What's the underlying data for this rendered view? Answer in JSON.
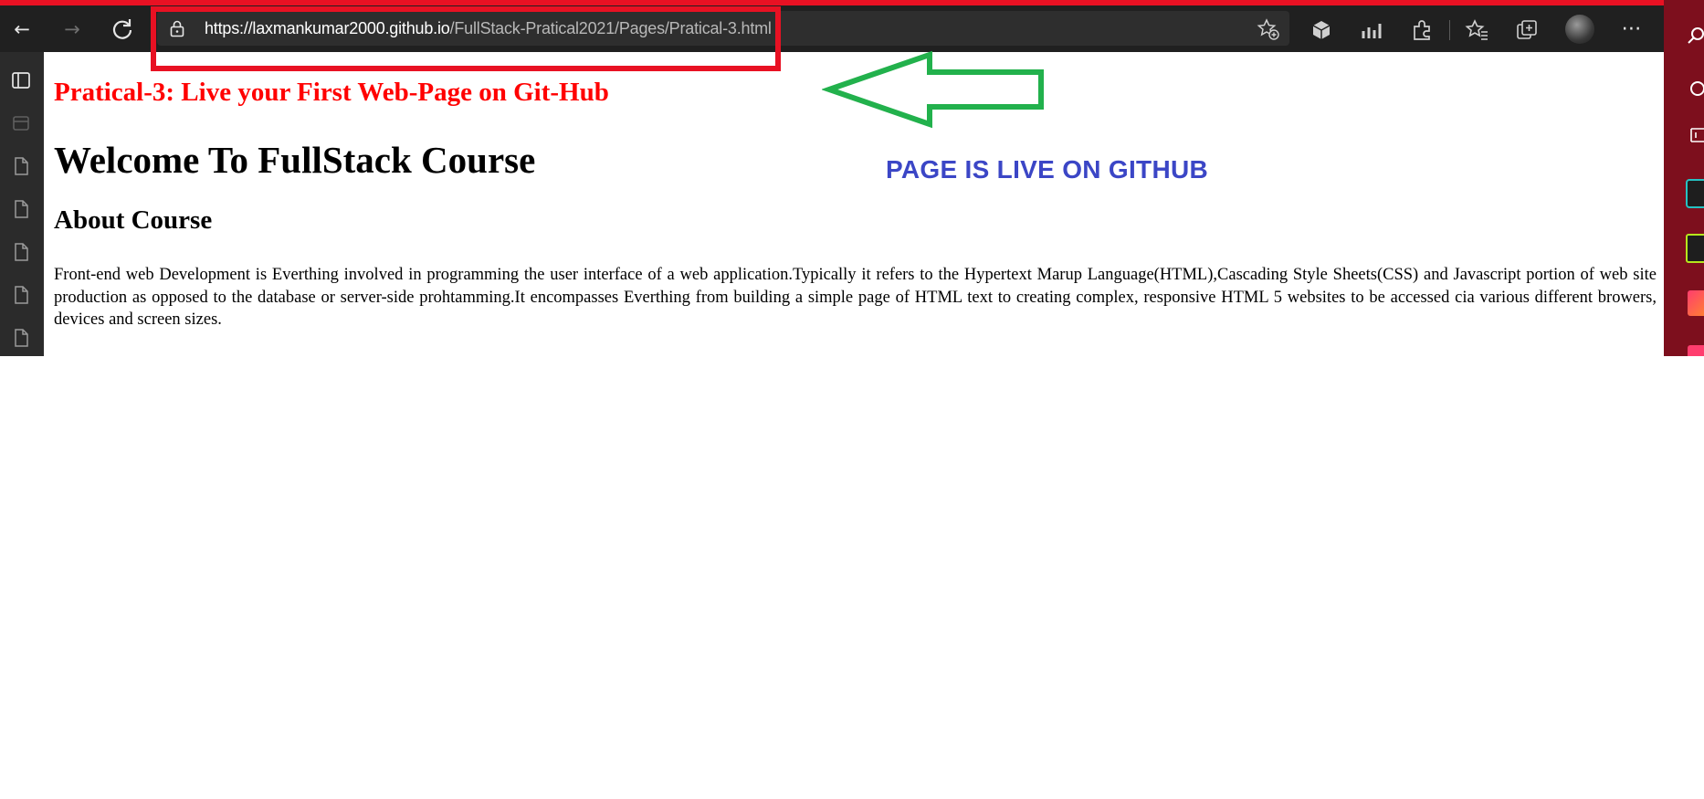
{
  "browser": {
    "address_bar": {
      "url_host": "https://laxmankumar2000.github.io",
      "url_path": "/FullStack-Pratical2021/Pages/Pratical-3.html"
    },
    "toolbar_icons": [
      "back-icon",
      "forward-icon",
      "refresh-icon",
      "lock-icon",
      "add-favorite-icon",
      "extension-cube-icon",
      "performance-icon",
      "extensions-puzzle-icon",
      "favorites-icon",
      "collections-icon",
      "profile-avatar",
      "more-options-icon"
    ],
    "sidebar_icons": [
      "tab-actions-icon",
      "saved-tab-icon",
      "page-icon",
      "page-icon",
      "page-icon",
      "page-icon",
      "page-icon"
    ],
    "highlight_color": "#e81123"
  },
  "page": {
    "practical_title": "Pratical-3: Live your First Web-Page on Git-Hub",
    "main_heading": "Welcome To FullStack Course",
    "section_heading": "About Course",
    "paragraph": "Front-end web Development is Everthing involved in programming the user interface of a web application.Typically it refers to the Hypertext Marup Language(HTML),Cascading Style Sheets(CSS) and Javascript portion of web site production as opposed to the database or server-side prohtamming.It encompasses Everthing from building a simple page of HTML text to creating complex, responsive HTML 5 websites to be accessed cia various different browers, devices and screen sizes."
  },
  "annotation": {
    "label": "PAGE IS LIVE ON GITHUB",
    "label_color": "#3b46c6",
    "arrow_color": "#22b14c",
    "box_color": "#e81123"
  }
}
